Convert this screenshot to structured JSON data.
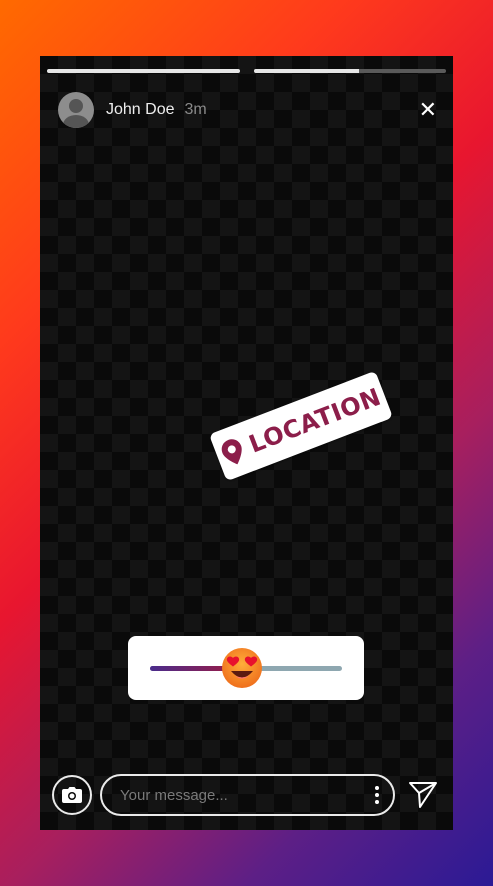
{
  "story": {
    "progress": [
      1.0,
      0.55
    ],
    "user": {
      "name": "John Doe",
      "time": "3m",
      "avatar_icon": "default-user-avatar"
    },
    "close_icon": "close-icon",
    "close_glyph": "✕"
  },
  "stickers": {
    "location": {
      "text": "LOCATION",
      "icon": "location-pin-icon",
      "color": "#8c1e4a"
    },
    "emoji_slider": {
      "value": 0.48,
      "emoji": "heart-eyes-emoji",
      "track_fill_colors": [
        "#4a2c8c",
        "#a01a40"
      ],
      "track_color": "#8ea7b0"
    }
  },
  "composer": {
    "camera_icon": "camera-icon",
    "placeholder": "Your message...",
    "value": "",
    "more_icon": "more-vertical-icon",
    "send_icon": "send-icon"
  }
}
